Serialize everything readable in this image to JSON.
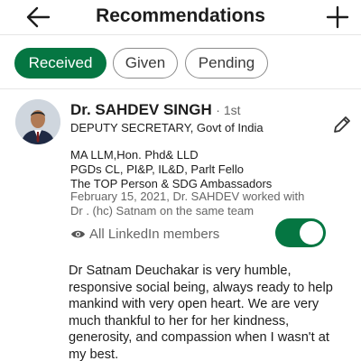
{
  "header": {
    "title": "Recommendations",
    "back_icon": "arrow-left-icon",
    "add_icon": "plus-icon"
  },
  "tabs": [
    {
      "label": "Received",
      "selected": true
    },
    {
      "label": "Given",
      "selected": false
    },
    {
      "label": "Pending",
      "selected": false
    }
  ],
  "recommendation": {
    "name": "Dr.  SAHDEV SINGH",
    "degree": "· 1st",
    "headline": "DEPUTY SECRETARY, Govt of India",
    "details_line1": "MA LLM,Hon. Phd& LLD",
    "details_line2": "PGDs CL, PI&P, IL&D, Parlt Fello",
    "details_line3": "The TOP Person & SDG Ambassadors",
    "date_line1": "February 15, 2021, Dr.  SAHDEV worked with",
    "date_line2": "Dr . (hc) Satnam on the same team",
    "visibility_label": "All LinkedIn members",
    "visibility_on": true,
    "text": "Dr Satnam Deuchakar  is very humble, responsive social being, always ready to help mankind with very open heart. We are very much thankful to her for her kindness, generosity, and compassion when I wasn't at my best."
  },
  "colors": {
    "accent": "#057642",
    "text": "#1d1d1d",
    "muted": "#666666"
  }
}
